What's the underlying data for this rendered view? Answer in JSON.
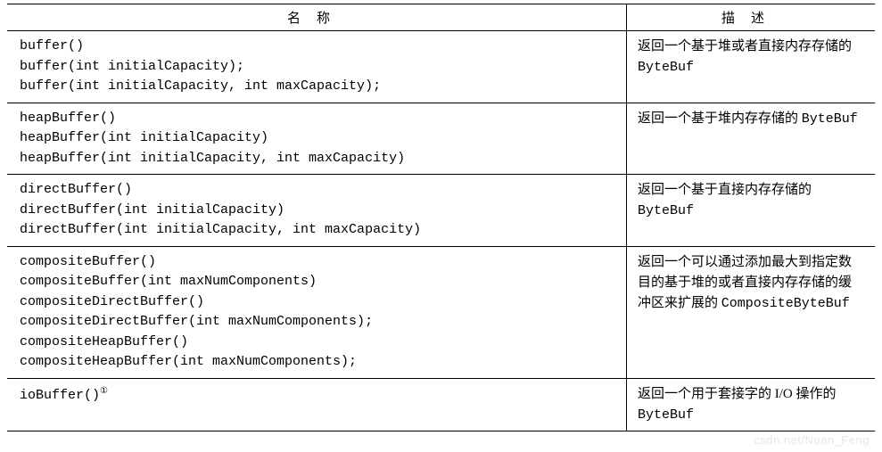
{
  "header": {
    "name": "名称",
    "desc": "描述"
  },
  "rows": [
    {
      "name_lines": [
        "buffer()",
        "buffer(int initialCapacity);",
        "buffer(int initialCapacity, int maxCapacity);"
      ],
      "desc_html": "返回一个基于堆或者直接内存存储的 <span class=\"mono\">ByteBuf</span>"
    },
    {
      "name_lines": [
        "heapBuffer()",
        "heapBuffer(int initialCapacity)",
        "heapBuffer(int initialCapacity, int maxCapacity)"
      ],
      "desc_html": "返回一个基于堆内存存储的 <span class=\"mono\">ByteBuf</span>"
    },
    {
      "name_lines": [
        "directBuffer()",
        "directBuffer(int initialCapacity)",
        "directBuffer(int initialCapacity, int maxCapacity)"
      ],
      "desc_html": "返回一个基于直接内存存储的 <span class=\"mono\">ByteBuf</span>"
    },
    {
      "name_lines": [
        "compositeBuffer()",
        "compositeBuffer(int maxNumComponents)",
        "compositeDirectBuffer()",
        "compositeDirectBuffer(int maxNumComponents);",
        "compositeHeapBuffer()",
        "compositeHeapBuffer(int maxNumComponents);"
      ],
      "desc_html": "返回一个可以通过添加最大到指定数目的基于堆的或者直接内存存储的缓冲区来扩展的 <span class=\"mono\">CompositeByteBuf</span>"
    },
    {
      "name_html": "ioBuffer()<span class=\"sup\">①</span>",
      "desc_html": "返回一个用于套接字的 I/O 操作的 <span class=\"mono\">ByteBuf</span>"
    }
  ],
  "watermark": "csdn.net/Nuan_Feng"
}
